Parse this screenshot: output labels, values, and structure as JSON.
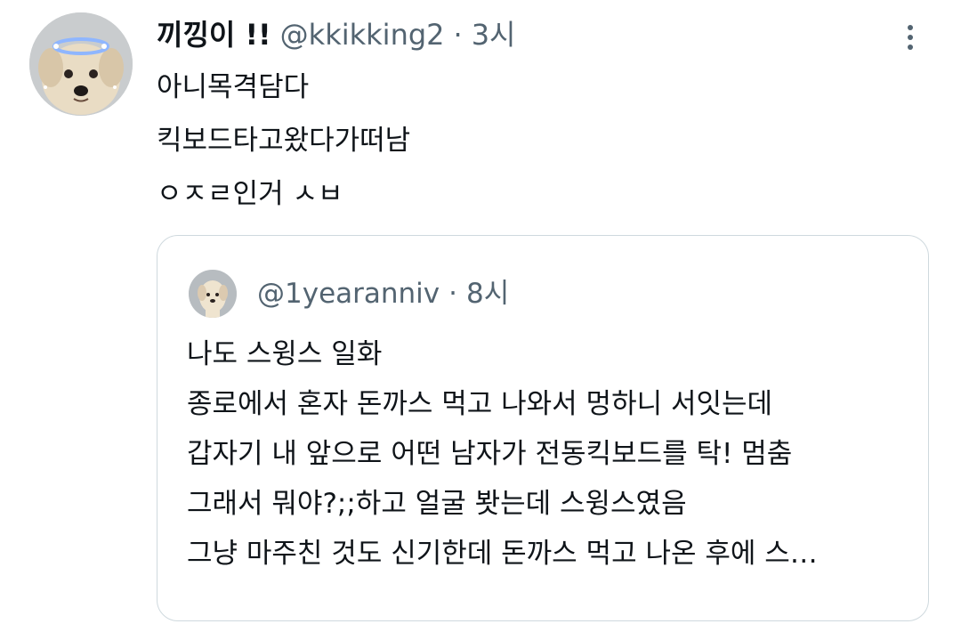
{
  "tweet": {
    "display_name": "끼낑이 !!",
    "handle": "@kkikking2",
    "separator": "·",
    "time": "3시",
    "more_icon": "more-vertical-icon",
    "avatar_icon": "puppy-halo-avatar",
    "lines": [
      "아니목격담다",
      "킥보드타고왔다가떠남",
      "ㅇㅈㄹ인거 ㅅㅂ"
    ]
  },
  "quoted_tweet": {
    "handle": "@1yearanniv",
    "separator": "·",
    "time": "8시",
    "avatar_icon": "puppy-avatar",
    "lines": [
      "나도 스윙스 일화",
      "종로에서 혼자 돈까스 먹고 나와서 멍하니 서잇는데",
      "갑자기 내 앞으로 어떤 남자가 전동킥보드를 탁! 멈춤",
      "그래서 뭐야?;;하고 얼굴 봣는데 스윙스였음",
      "그냥 마주친 것도 신기한데 돈까스 먹고 나온 후에 스…"
    ]
  },
  "colors": {
    "text_primary": "#0f1419",
    "text_secondary": "#536471",
    "border": "#cfd9de"
  }
}
